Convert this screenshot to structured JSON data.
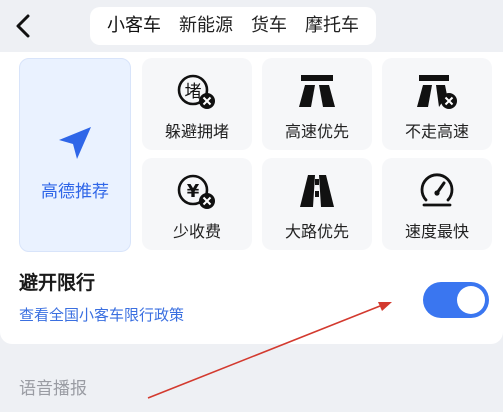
{
  "header": {
    "back_icon": "chevron-left-icon",
    "tabs": [
      {
        "label": "小客车",
        "active": true
      },
      {
        "label": "新能源",
        "active": false
      },
      {
        "label": "货车",
        "active": false
      },
      {
        "label": "摩托车",
        "active": false
      }
    ]
  },
  "route_prefs": {
    "recommend": {
      "label": "高德推荐",
      "icon": "navigation-arrow-icon",
      "color": "#2f66e8"
    },
    "options": [
      {
        "label": "躲避拥堵",
        "icon": "avoid-congestion-icon"
      },
      {
        "label": "高速优先",
        "icon": "highway-icon"
      },
      {
        "label": "不走高速",
        "icon": "no-highway-icon"
      },
      {
        "label": "少收费",
        "icon": "less-toll-icon"
      },
      {
        "label": "大路优先",
        "icon": "main-road-icon"
      },
      {
        "label": "速度最快",
        "icon": "speedometer-icon"
      }
    ]
  },
  "limit": {
    "title": "避开限行",
    "link": "查看全国小客车限行政策",
    "toggle_on": true
  },
  "voice": {
    "label": "语音播报"
  },
  "colors": {
    "accent": "#3a76f0",
    "link": "#3a6fe0",
    "annotation_arrow": "#d33a2f"
  }
}
